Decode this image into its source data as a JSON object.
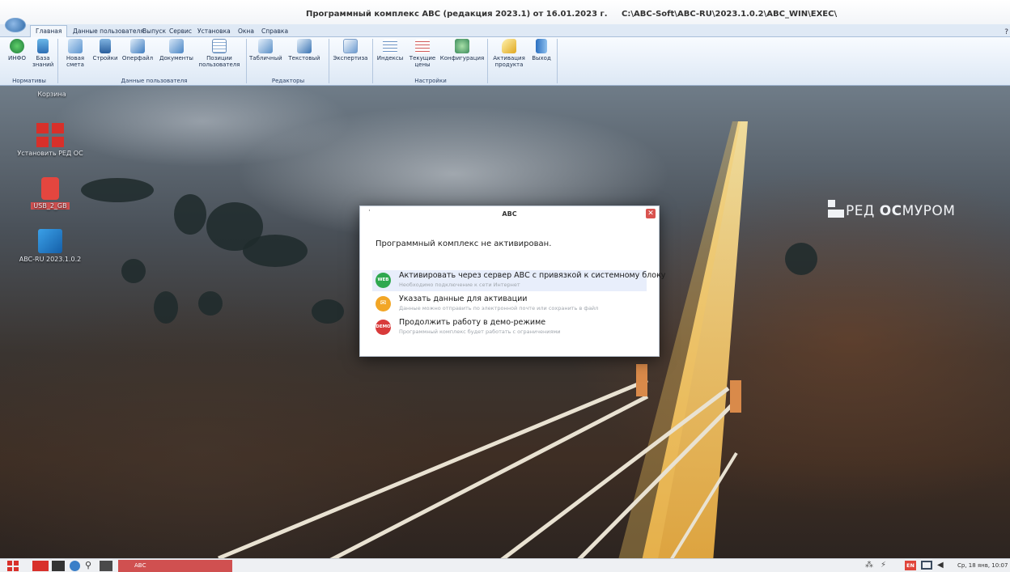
{
  "window": {
    "title": "Программный комплекс АВС (редакция 2023.1) от 16.01.2023 г.",
    "path": "C:\\ABC-Soft\\ABC-RU\\2023.1.0.2\\ABC_WIN\\EXEC\\"
  },
  "ribbon": {
    "tabs": [
      {
        "label": "Главная",
        "active": true
      },
      {
        "label": "Данные пользователя"
      },
      {
        "label": "Выпуск"
      },
      {
        "label": "Сервис"
      },
      {
        "label": "Установка"
      },
      {
        "label": "Окна"
      },
      {
        "label": "Справка"
      }
    ],
    "buttons": {
      "info": "ИНФО",
      "knowledge_base": "База знаний",
      "new_estimate": "Новая смета",
      "constructions": "Стройки",
      "operfile": "Оперфайл",
      "documents": "Документы",
      "user_positions": "Позиции пользователя",
      "table_editor": "Табличный",
      "text_editor": "Текстовый",
      "expertise": "Экспертиза",
      "indices": "Индексы",
      "current_prices": "Текущие цены",
      "configuration": "Конфигурация",
      "activation": "Активация продукта",
      "exit": "Выход"
    },
    "groups": {
      "normatives": "Нормативы",
      "user_data": "Данные пользователя",
      "editors": "Редакторы",
      "settings": "Настройки"
    }
  },
  "desktop": {
    "icons": [
      {
        "label": "Корзина"
      },
      {
        "label": "Установить РЕД ОС"
      },
      {
        "label": "USB_2_GB"
      },
      {
        "label": "ABC-RU 2023.1.0.2"
      }
    ],
    "wallpaper_logo": {
      "part1": "РЕД ",
      "part2": "ОС",
      "part3": "МУРОМ"
    }
  },
  "dialog": {
    "title": "АВС",
    "message": "Программный комплекс не активирован.",
    "options": [
      {
        "badge": "WEB",
        "title": "Активировать через сервер АВС с привязкой к системному блоку",
        "subtitle": "Необходимо подключение к сети Интернет",
        "color": "#2fa84f"
      },
      {
        "badge": "✉",
        "title": "Указать данные для активации",
        "subtitle": "Данные можно отправить по электронной почте или сохранить в файл",
        "color": "#f2a626"
      },
      {
        "badge": "DEMO",
        "title": "Продолжить работу в демо-режиме",
        "subtitle": "Программный комплекс будет работать с ограничениями",
        "color": "#d83a3a"
      }
    ]
  },
  "taskbar": {
    "task_label": "АВС",
    "lang": "EN",
    "clock": "Ср, 18 янв, 10:07"
  }
}
